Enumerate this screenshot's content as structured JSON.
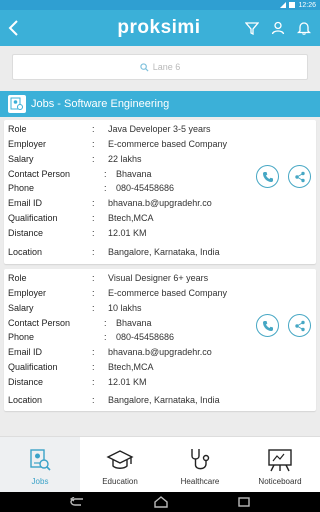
{
  "status_bar": {
    "time": "12:26"
  },
  "app_bar": {
    "logo_text": "proksimi"
  },
  "search": {
    "placeholder": "Lane 6"
  },
  "section": {
    "title": "Jobs - Software Engineering"
  },
  "jobs": [
    {
      "role_label": "Role",
      "role": "Java Developer 3-5 years",
      "employer_label": "Employer",
      "employer": "E-commerce based Company",
      "salary_label": "Salary",
      "salary": "22 lakhs",
      "contact_label": "Contact Person",
      "contact": "Bhavana",
      "phone_label": "Phone",
      "phone": "080-45458686",
      "email_label": "Email ID",
      "email": "bhavana.b@upgradehr.co",
      "qualification_label": "Qualification",
      "qualification": "Btech,MCA",
      "distance_label": "Distance",
      "distance": "12.01 KM",
      "location_label": "Location",
      "location": "Bangalore, Karnataka, India"
    },
    {
      "role_label": "Role",
      "role": "Visual Designer 6+ years",
      "employer_label": "Employer",
      "employer": "E-commerce based Company",
      "salary_label": "Salary",
      "salary": "10 lakhs",
      "contact_label": "Contact Person",
      "contact": "Bhavana",
      "phone_label": "Phone",
      "phone": "080-45458686",
      "email_label": "Email ID",
      "email": "bhavana.b@upgradehr.co",
      "qualification_label": "Qualification",
      "qualification": "Btech,MCA",
      "distance_label": "Distance",
      "distance": "12.01 KM",
      "location_label": "Location",
      "location": "Bangalore, Karnataka, India"
    }
  ],
  "colon": ":",
  "bottom_nav": [
    {
      "label": "Jobs",
      "icon": "jobs-icon",
      "active": true
    },
    {
      "label": "Education",
      "icon": "graduation-cap-icon",
      "active": false
    },
    {
      "label": "Healthcare",
      "icon": "stethoscope-icon",
      "active": false
    },
    {
      "label": "Noticeboard",
      "icon": "noticeboard-icon",
      "active": false
    }
  ],
  "colors": {
    "primary": "#3bb0d8",
    "accent_outline": "#46a7c4",
    "background": "#ececec"
  }
}
